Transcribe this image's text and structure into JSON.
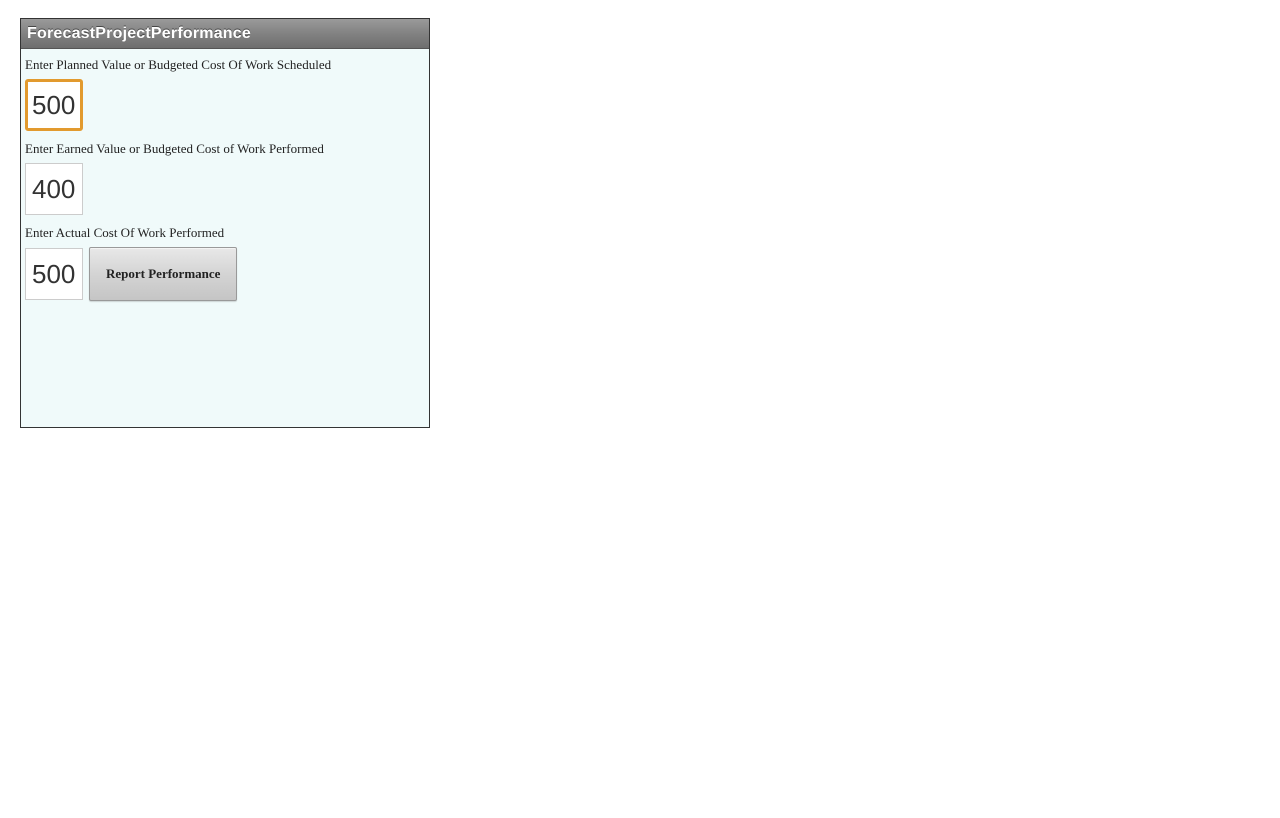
{
  "window": {
    "title": "ForecastProjectPerformance"
  },
  "fields": {
    "planned_value": {
      "label": "Enter Planned Value or Budgeted Cost Of Work Scheduled",
      "value": "500"
    },
    "earned_value": {
      "label": "Enter Earned Value or Budgeted Cost of Work Performed",
      "value": "400"
    },
    "actual_cost": {
      "label": "Enter Actual Cost Of Work Performed",
      "value": "500"
    }
  },
  "buttons": {
    "report_performance": "Report Performance"
  }
}
